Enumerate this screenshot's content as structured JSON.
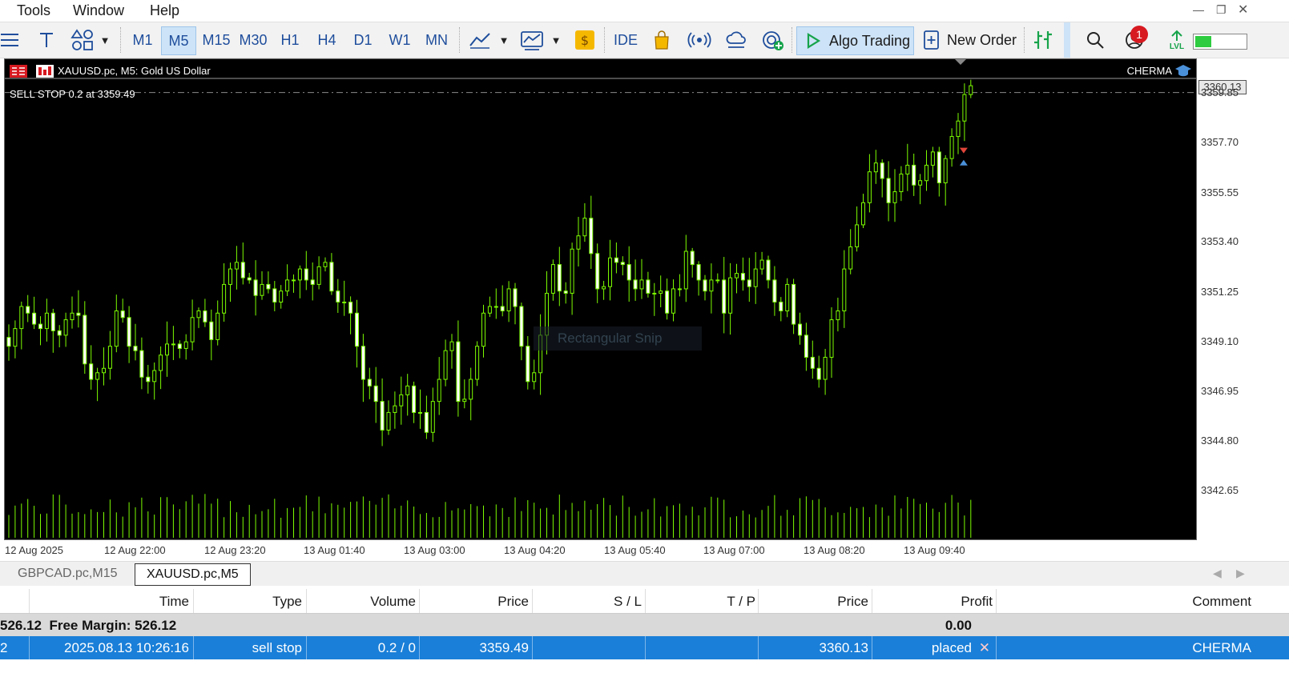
{
  "menu": {
    "items": [
      "Tools",
      "Window",
      "Help"
    ]
  },
  "toolbar": {
    "timeframes": [
      "M1",
      "M5",
      "M15",
      "M30",
      "H1",
      "H4",
      "D1",
      "W1",
      "MN"
    ],
    "active_timeframe": "M5",
    "ide_label": "IDE",
    "algo_trading_label": "Algo Trading",
    "new_order_label": "New Order",
    "notification_count": "1",
    "lvl_label": "LVL",
    "accent_green": "#16a34a",
    "accent_blue": "#1f4e9c"
  },
  "chart": {
    "title": "XAUUSD.pc, M5:  Gold US Dollar",
    "broker": "CHERMA",
    "order_label": "SELL STOP 0.2 at 3359.49",
    "watermark": "Rectangular Snip",
    "current_price": "3360.13",
    "price_ticks": [
      "3359.85",
      "3357.70",
      "3355.55",
      "3353.40",
      "3351.25",
      "3349.10",
      "3346.95",
      "3344.80",
      "3342.65"
    ],
    "time_ticks": [
      "12 Aug 2025",
      "12 Aug 22:00",
      "12 Aug 23:20",
      "13 Aug 01:40",
      "13 Aug 03:00",
      "13 Aug 04:20",
      "13 Aug 05:40",
      "13 Aug 07:00",
      "13 Aug 08:20",
      "13 Aug 09:40"
    ],
    "bull_color": "#7cfc00",
    "bear_color": "#ffffff"
  },
  "chart_data": {
    "type": "candlestick",
    "symbol": "XAUUSD.pc",
    "timeframe": "M5",
    "ylim": [
      3341.5,
      3361.0
    ],
    "order_price": 3359.49,
    "last_price": 3360.13,
    "close": [
      3348.0,
      3348.8,
      3349.8,
      3349.5,
      3349.0,
      3348.8,
      3349.5,
      3348.7,
      3348.5,
      3349.2,
      3349.5,
      3349.4,
      3347.2,
      3346.5,
      3346.8,
      3347.0,
      3348.0,
      3349.6,
      3349.3,
      3348.0,
      3347.8,
      3346.6,
      3346.4,
      3346.9,
      3347.6,
      3348.1,
      3348.1,
      3347.9,
      3348.2,
      3349.3,
      3349.6,
      3349.1,
      3348.3,
      3349.5,
      3350.8,
      3351.5,
      3351.8,
      3351.1,
      3351.0,
      3350.3,
      3350.8,
      3350.6,
      3350.0,
      3350.5,
      3351.0,
      3351.0,
      3351.5,
      3351.0,
      3350.8,
      3351.6,
      3351.8,
      3350.5,
      3350.0,
      3350.0,
      3349.5,
      3348.0,
      3346.5,
      3346.2,
      3345.5,
      3344.2,
      3345.0,
      3345.3,
      3345.8,
      3346.2,
      3345.0,
      3345.0,
      3344.1,
      3345.5,
      3346.5,
      3347.8,
      3348.2,
      3345.5,
      3345.6,
      3346.5,
      3348.0,
      3349.5,
      3349.8,
      3349.8,
      3349.6,
      3350.6,
      3349.8,
      3348.0,
      3346.4,
      3346.8,
      3348.5,
      3350.4,
      3351.7,
      3350.5,
      3350.4,
      3352.4,
      3353.0,
      3353.8,
      3352.2,
      3350.6,
      3350.7,
      3352.0,
      3351.8,
      3351.7,
      3351.0,
      3350.6,
      3351.0,
      3350.4,
      3350.4,
      3350.5,
      3349.5,
      3350.6,
      3350.6,
      3352.3,
      3351.7,
      3351.0,
      3350.5,
      3351.0,
      3351.0,
      3349.5,
      3351.1,
      3351.3,
      3351.0,
      3350.7,
      3351.5,
      3351.9,
      3351.0,
      3350.0,
      3349.6,
      3350.8,
      3349.0,
      3348.5,
      3347.5,
      3347.0,
      3346.5,
      3347.5,
      3349.2,
      3349.6,
      3351.5,
      3352.5,
      3353.5,
      3354.5,
      3355.9,
      3356.3,
      3355.6,
      3354.5,
      3355.0,
      3355.8,
      3356.2,
      3355.3,
      3355.5,
      3356.2,
      3356.8,
      3355.4,
      3356.5,
      3357.5,
      3358.2,
      3359.4,
      3359.8
    ]
  },
  "tabs": {
    "items": [
      "GBPCAD.pc,M15",
      "XAUUSD.pc,M5"
    ],
    "active": "XAUUSD.pc,M5"
  },
  "table": {
    "headers": [
      "Time",
      "Type",
      "Volume",
      "Price",
      "S / L",
      "T / P",
      "Price",
      "Profit",
      "Comment"
    ],
    "balance": {
      "text": "526.12  Free Margin: 526.12",
      "profit": "0.00"
    },
    "row": {
      "id": "2",
      "time": "2025.08.13 10:26:16",
      "type": "sell stop",
      "volume": "0.2 / 0",
      "price": "3359.49",
      "sl": "",
      "tp": "",
      "current_price": "3360.13",
      "profit": "placed",
      "close_icon": "✕",
      "comment": "CHERMA"
    }
  }
}
